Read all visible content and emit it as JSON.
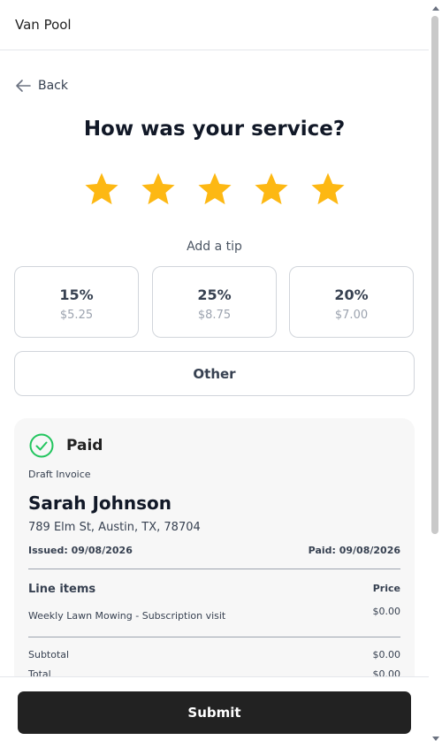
{
  "app": {
    "title": "Van Pool"
  },
  "nav": {
    "back_label": "Back"
  },
  "rating": {
    "question": "How was your service?",
    "max": 5,
    "value": 5,
    "color": "#FDB813"
  },
  "tip": {
    "label": "Add a tip",
    "options": [
      {
        "percent": "15%",
        "amount": "$5.25"
      },
      {
        "percent": "25%",
        "amount": "$8.75"
      },
      {
        "percent": "20%",
        "amount": "$7.00"
      }
    ],
    "other_label": "Other"
  },
  "invoice": {
    "status": "Paid",
    "status_color": "#22c55e",
    "type": "Draft Invoice",
    "client_name": "Sarah Johnson",
    "address": "789 Elm St, Austin, TX, 78704",
    "issued": "Issued: 09/08/2026",
    "paid_date": "Paid: 09/08/2026",
    "line_items_header": "Line items",
    "price_header": "Price",
    "items": [
      {
        "description": "Weekly Lawn Mowing - Subscription visit",
        "price": "$0.00"
      }
    ],
    "subtotal_label": "Subtotal",
    "subtotal": "$0.00",
    "total_label": "Total",
    "total": "$0.00"
  },
  "footer": {
    "submit_label": "Submit"
  }
}
